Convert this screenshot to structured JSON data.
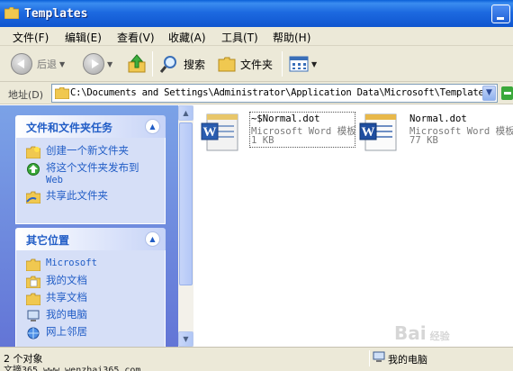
{
  "window": {
    "title": "Templates"
  },
  "menu": [
    "文件(F)",
    "编辑(E)",
    "查看(V)",
    "收藏(A)",
    "工具(T)",
    "帮助(H)"
  ],
  "toolbar": {
    "back_label": "后退",
    "search_label": "搜索",
    "folders_label": "文件夹"
  },
  "address": {
    "label": "地址(D)",
    "path": "C:\\Documents and Settings\\Administrator\\Application Data\\Microsoft\\Templates"
  },
  "tasks_panel": {
    "title": "文件和文件夹任务",
    "items": [
      {
        "label": "创建一个新文件夹",
        "icon": "new-folder-icon"
      },
      {
        "label": "将这个文件夹发布到",
        "label2": "Web",
        "icon": "publish-web-icon"
      },
      {
        "label": "共享此文件夹",
        "icon": "share-folder-icon"
      }
    ]
  },
  "places_panel": {
    "title": "其它位置",
    "items": [
      {
        "label": "Microsoft",
        "icon": "folder-icon"
      },
      {
        "label": "我的文档",
        "icon": "my-documents-icon"
      },
      {
        "label": "共享文档",
        "icon": "shared-documents-icon"
      },
      {
        "label": "我的电脑",
        "icon": "my-computer-icon"
      },
      {
        "label": "网上邻居",
        "icon": "network-places-icon"
      }
    ]
  },
  "files": [
    {
      "name": "~$Normal.dot",
      "type": "Microsoft Word 模板",
      "size": "1 KB",
      "selected": true
    },
    {
      "name": "Normal.dot",
      "type": "Microsoft Word 模板",
      "size": "77 KB",
      "selected": false
    }
  ],
  "status": {
    "count": "2 个对象",
    "location": "我的电脑",
    "overlay_url": "文摘365 www.wenzhai365.com"
  },
  "watermark": {
    "text": "Bai",
    "sub": "经验"
  },
  "colors": {
    "title_bar": "#0f55cf",
    "task_link": "#215dc6",
    "pane_bg": "#6375d6"
  }
}
